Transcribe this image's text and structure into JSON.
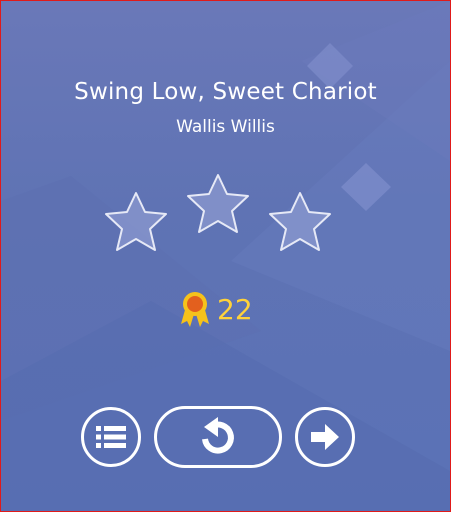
{
  "song": {
    "title": "Swing Low, Sweet Chariot",
    "artist": "Wallis Willis"
  },
  "rating": {
    "stars_earned": 0,
    "stars_total": 3
  },
  "score": {
    "icon": "medal-icon",
    "value": "22"
  },
  "buttons": {
    "list": {
      "icon": "list-icon"
    },
    "restart": {
      "icon": "restart-icon"
    },
    "next": {
      "icon": "arrow-right-icon"
    }
  },
  "colors": {
    "background": "#5f73b4",
    "score": "#ffd23a",
    "button_outline": "#ffffff",
    "frame": "#e01a1a"
  }
}
